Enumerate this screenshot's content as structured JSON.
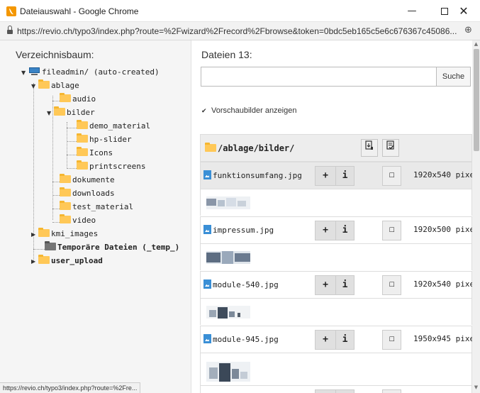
{
  "window": {
    "title": "Dateiauswahl - Google Chrome",
    "minimize_glyph": "—",
    "close_glyph": "✕"
  },
  "address": {
    "url": "https://revio.ch/typo3/index.php?route=%2Fwizard%2Frecord%2Fbrowse&token=0bdc5eb165c5e6c676367c45086...",
    "icons": [
      "lock-icon",
      "zoom-icon"
    ]
  },
  "tree": {
    "heading": "Verzeichnisbaum:",
    "items": [
      {
        "label": "fileadmin/ (auto-created)",
        "icon": "mount-icon",
        "expanded": true
      },
      {
        "label": "ablage",
        "icon": "folder-icon",
        "expanded": true
      },
      {
        "label": "audio",
        "icon": "folder-icon"
      },
      {
        "label": "bilder",
        "icon": "folder-icon",
        "expanded": true
      },
      {
        "label": "demo_material",
        "icon": "folder-icon"
      },
      {
        "label": "hp-slider",
        "icon": "folder-icon"
      },
      {
        "label": "Icons",
        "icon": "folder-icon"
      },
      {
        "label": "printscreens",
        "icon": "folder-icon"
      },
      {
        "label": "dokumente",
        "icon": "folder-icon"
      },
      {
        "label": "downloads",
        "icon": "folder-icon"
      },
      {
        "label": "test_material",
        "icon": "folder-icon"
      },
      {
        "label": "video",
        "icon": "folder-icon"
      },
      {
        "label": "kmi_images",
        "icon": "folder-icon",
        "expanded": false
      },
      {
        "label": "Temporäre Dateien (_temp_)",
        "icon": "folder-grey-icon"
      },
      {
        "label": "user_upload",
        "icon": "folder-icon",
        "expanded": false
      }
    ]
  },
  "files": {
    "heading": "Dateien 13:",
    "search_value": "",
    "search_button": "Suche",
    "show_thumbnails_label": "Vorschaubilder anzeigen",
    "show_thumbnails_checked": true,
    "path": "/ablage/bilder/",
    "header_buttons": [
      "import-icon",
      "select-all-icon"
    ],
    "rows": [
      {
        "name": "funktionsumfang.jpg",
        "dims": "1920x540 pixe",
        "highlighted": true
      },
      {
        "name": "impressum.jpg",
        "dims": "1920x500 pixe",
        "highlighted": false
      },
      {
        "name": "module-540.jpg",
        "dims": "1920x540 pixe",
        "highlighted": false
      },
      {
        "name": "module-945.jpg",
        "dims": "1950x945 pixe",
        "highlighted": false
      }
    ],
    "add_label": "+",
    "info_label": "i",
    "checkbox_glyph": "☐"
  },
  "status": {
    "text": "https://revio.ch/typo3/index.php?route=%2Fre..."
  },
  "colors": {
    "folder": "#ffc857",
    "folder_grey": "#757575",
    "file_icon": "#3a8fd6",
    "tree_bg": "#f5f5f5"
  }
}
